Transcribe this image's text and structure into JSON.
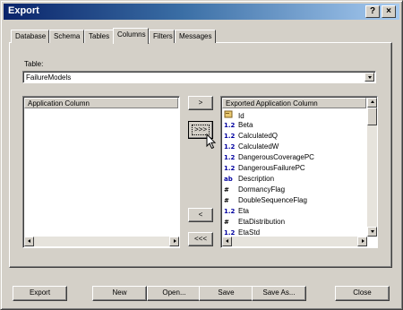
{
  "window": {
    "title": "Export"
  },
  "title_buttons": {
    "help": "?",
    "close": "×"
  },
  "tabs": [
    "Database",
    "Schema",
    "Tables",
    "Columns",
    "Filters",
    "Messages"
  ],
  "active_tab": "Columns",
  "table": {
    "label": "Table:",
    "value": "FailureModels"
  },
  "left_list": {
    "header": "Application Column"
  },
  "right_list": {
    "header": "Exported Application Column",
    "items": [
      {
        "icon": "key-icon",
        "prefix": "",
        "text": "Id"
      },
      {
        "icon": "number-icon",
        "prefix": "1.2",
        "text": "Beta"
      },
      {
        "icon": "number-icon",
        "prefix": "1.2",
        "text": "CalculatedQ"
      },
      {
        "icon": "number-icon",
        "prefix": "1.2",
        "text": "CalculatedW"
      },
      {
        "icon": "number-icon",
        "prefix": "1.2",
        "text": "DangerousCoveragePC"
      },
      {
        "icon": "number-icon",
        "prefix": "1.2",
        "text": "DangerousFailurePC"
      },
      {
        "icon": "text-icon",
        "prefix": "ab",
        "text": "Description"
      },
      {
        "icon": "hash-icon",
        "prefix": "#",
        "text": "DormancyFlag"
      },
      {
        "icon": "hash-icon",
        "prefix": "#",
        "text": "DoubleSequenceFlag"
      },
      {
        "icon": "number-icon",
        "prefix": "1.2",
        "text": "Eta"
      },
      {
        "icon": "hash-icon",
        "prefix": "#",
        "text": "EtaDistribution"
      },
      {
        "icon": "number-icon",
        "prefix": "1.2",
        "text": "EtaStd"
      }
    ]
  },
  "transfer_buttons": {
    "add": ">",
    "add_all": ">>>",
    "remove": "<",
    "remove_all": "<<<"
  },
  "footer_buttons": {
    "export": "Export",
    "new": "New",
    "open": "Open...",
    "save": "Save",
    "save_as": "Save As...",
    "close": "Close"
  }
}
